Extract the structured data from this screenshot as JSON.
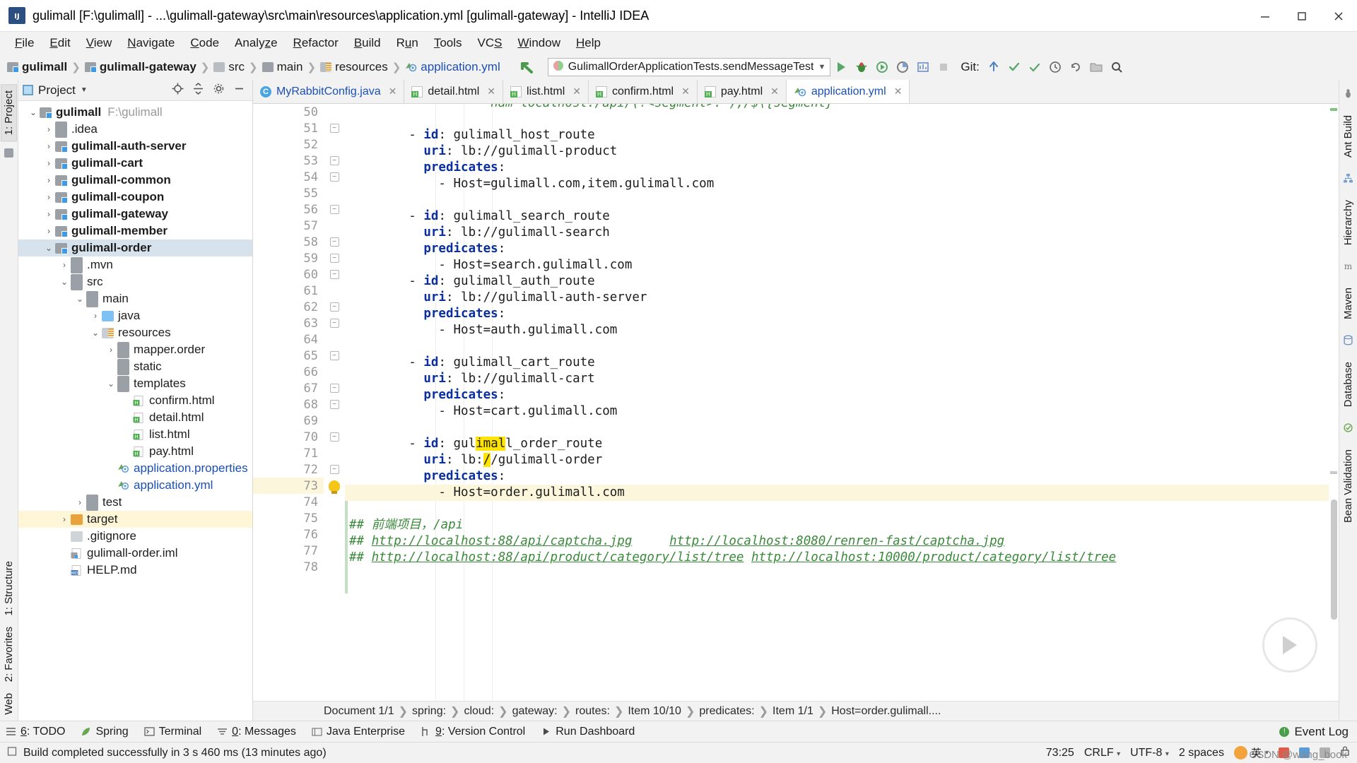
{
  "window": {
    "title": "gulimall [F:\\gulimall] - ...\\gulimall-gateway\\src\\main\\resources\\application.yml [gulimall-gateway] - IntelliJ IDEA",
    "app_icon_letter": "IJ",
    "minimize": "—",
    "maximize": "□",
    "close": "✕"
  },
  "menu": {
    "items": [
      {
        "label": "File"
      },
      {
        "label": "Edit"
      },
      {
        "label": "View"
      },
      {
        "label": "Navigate"
      },
      {
        "label": "Code"
      },
      {
        "label": "Analyze"
      },
      {
        "label": "Refactor"
      },
      {
        "label": "Build"
      },
      {
        "label": "Run"
      },
      {
        "label": "Tools"
      },
      {
        "label": "VCS"
      },
      {
        "label": "Window"
      },
      {
        "label": "Help"
      }
    ]
  },
  "navbar": {
    "crumbs": [
      {
        "label": "gulimall",
        "icon": "module-icon"
      },
      {
        "label": "gulimall-gateway",
        "icon": "module-icon"
      },
      {
        "label": "src",
        "icon": "source-folder-icon"
      },
      {
        "label": "main",
        "icon": "folder-icon"
      },
      {
        "label": "resources",
        "icon": "resources-folder-icon"
      },
      {
        "label": "application.yml",
        "icon": "yml-file-icon"
      }
    ],
    "run_config": "GulimallOrderApplicationTests.sendMessageTest",
    "git_label": "Git:",
    "actions": [
      "run-button",
      "debug-button",
      "run-coverage-button",
      "profiler-button",
      "build-button",
      "stop-button"
    ]
  },
  "project_panel": {
    "title": "Project",
    "header_actions": [
      "locate-icon",
      "collapse-all-icon",
      "settings-icon",
      "hide-icon"
    ],
    "tree": [
      {
        "label": "gulimall",
        "path": "F:\\gulimall",
        "depth": 0,
        "arrow": "down",
        "icon": "module-icon",
        "bold": true
      },
      {
        "label": ".idea",
        "depth": 1,
        "arrow": "right",
        "icon": "folder-icon"
      },
      {
        "label": "gulimall-auth-server",
        "depth": 1,
        "arrow": "right",
        "icon": "module-icon",
        "bold": true
      },
      {
        "label": "gulimall-cart",
        "depth": 1,
        "arrow": "right",
        "icon": "module-icon",
        "bold": true
      },
      {
        "label": "gulimall-common",
        "depth": 1,
        "arrow": "right",
        "icon": "module-icon",
        "bold": true
      },
      {
        "label": "gulimall-coupon",
        "depth": 1,
        "arrow": "right",
        "icon": "module-icon",
        "bold": true
      },
      {
        "label": "gulimall-gateway",
        "depth": 1,
        "arrow": "right",
        "icon": "module-icon",
        "bold": true
      },
      {
        "label": "gulimall-member",
        "depth": 1,
        "arrow": "right",
        "icon": "module-icon",
        "bold": true
      },
      {
        "label": "gulimall-order",
        "depth": 1,
        "arrow": "down",
        "icon": "module-icon",
        "bold": true,
        "selected": true
      },
      {
        "label": ".mvn",
        "depth": 2,
        "arrow": "right",
        "icon": "folder-icon"
      },
      {
        "label": "src",
        "depth": 2,
        "arrow": "down",
        "icon": "folder-icon"
      },
      {
        "label": "main",
        "depth": 3,
        "arrow": "down",
        "icon": "folder-icon"
      },
      {
        "label": "java",
        "depth": 4,
        "arrow": "right",
        "icon": "source-folder-icon"
      },
      {
        "label": "resources",
        "depth": 4,
        "arrow": "down",
        "icon": "resources-folder-icon"
      },
      {
        "label": "mapper.order",
        "depth": 5,
        "arrow": "right",
        "icon": "folder-icon"
      },
      {
        "label": "static",
        "depth": 5,
        "arrow": "none",
        "icon": "folder-icon"
      },
      {
        "label": "templates",
        "depth": 5,
        "arrow": "down",
        "icon": "folder-icon"
      },
      {
        "label": "confirm.html",
        "depth": 6,
        "arrow": "none",
        "icon": "html-file-icon"
      },
      {
        "label": "detail.html",
        "depth": 6,
        "arrow": "none",
        "icon": "html-file-icon"
      },
      {
        "label": "list.html",
        "depth": 6,
        "arrow": "none",
        "icon": "html-file-icon"
      },
      {
        "label": "pay.html",
        "depth": 6,
        "arrow": "none",
        "icon": "html-file-icon"
      },
      {
        "label": "application.properties",
        "depth": 5,
        "arrow": "none",
        "icon": "properties-file-icon",
        "color": "blue"
      },
      {
        "label": "application.yml",
        "depth": 5,
        "arrow": "none",
        "icon": "yml-file-icon",
        "color": "blue"
      },
      {
        "label": "test",
        "depth": 3,
        "arrow": "right",
        "icon": "folder-icon"
      },
      {
        "label": "target",
        "depth": 2,
        "arrow": "right",
        "icon": "target-folder-icon",
        "highlight": true
      },
      {
        "label": ".gitignore",
        "depth": 2,
        "arrow": "none",
        "icon": "file-icon"
      },
      {
        "label": "gulimall-order.iml",
        "depth": 2,
        "arrow": "none",
        "icon": "iml-file-icon"
      },
      {
        "label": "HELP.md",
        "depth": 2,
        "arrow": "none",
        "icon": "markdown-file-icon"
      }
    ]
  },
  "editor": {
    "tabs": [
      {
        "label": "MyRabbitConfig.java",
        "icon": "java-class-icon",
        "active": false
      },
      {
        "label": "detail.html",
        "icon": "html-file-icon",
        "active": false
      },
      {
        "label": "list.html",
        "icon": "html-file-icon",
        "active": false
      },
      {
        "label": "confirm.html",
        "icon": "html-file-icon",
        "active": false
      },
      {
        "label": "pay.html",
        "icon": "html-file-icon",
        "active": false
      },
      {
        "label": "application.yml",
        "icon": "yml-file-icon",
        "active": true
      }
    ],
    "first_line_number": 50,
    "highlight_line": 73,
    "lines": [
      {
        "n": 50,
        "text": "",
        "fold": ""
      },
      {
        "n": 51,
        "text": "        - id: gulimall_host_route",
        "fold": "collapse",
        "tokens": [
          {
            "t": "        - ",
            "c": ""
          },
          {
            "t": "id",
            "c": "kw"
          },
          {
            "t": ": gulimall_host_route",
            "c": ""
          }
        ]
      },
      {
        "n": 52,
        "text": "          uri: lb://gulimall-product",
        "fold": "",
        "tokens": [
          {
            "t": "          ",
            "c": ""
          },
          {
            "t": "uri",
            "c": "kw"
          },
          {
            "t": ": lb://gulimall-product",
            "c": ""
          }
        ]
      },
      {
        "n": 53,
        "text": "          predicates:",
        "fold": "collapse",
        "tokens": [
          {
            "t": "          ",
            "c": ""
          },
          {
            "t": "predicates",
            "c": "kw"
          },
          {
            "t": ":",
            "c": ""
          }
        ]
      },
      {
        "n": 54,
        "text": "            - Host=gulimall.com,item.gulimall.com",
        "fold": "collapse",
        "tokens": [
          {
            "t": "            - Host=gulimall.com,item.gulimall.com",
            "c": ""
          }
        ]
      },
      {
        "n": 55,
        "text": "",
        "fold": ""
      },
      {
        "n": 56,
        "text": "        - id: gulimall_search_route",
        "fold": "collapse",
        "tokens": [
          {
            "t": "        - ",
            "c": ""
          },
          {
            "t": "id",
            "c": "kw"
          },
          {
            "t": ": gulimall_search_route",
            "c": ""
          }
        ]
      },
      {
        "n": 57,
        "text": "          uri: lb://gulimall-search",
        "fold": "",
        "tokens": [
          {
            "t": "          ",
            "c": ""
          },
          {
            "t": "uri",
            "c": "kw"
          },
          {
            "t": ": lb://gulimall-search",
            "c": ""
          }
        ]
      },
      {
        "n": 58,
        "text": "          predicates:",
        "fold": "collapse",
        "tokens": [
          {
            "t": "          ",
            "c": ""
          },
          {
            "t": "predicates",
            "c": "kw"
          },
          {
            "t": ":",
            "c": ""
          }
        ]
      },
      {
        "n": 59,
        "text": "            - Host=search.gulimall.com",
        "fold": "collapse",
        "tokens": [
          {
            "t": "            - Host=search.gulimall.com",
            "c": ""
          }
        ]
      },
      {
        "n": 60,
        "text": "        - id: gulimall_auth_route",
        "fold": "collapse",
        "tokens": [
          {
            "t": "        - ",
            "c": ""
          },
          {
            "t": "id",
            "c": "kw"
          },
          {
            "t": ": gulimall_auth_route",
            "c": ""
          }
        ]
      },
      {
        "n": 61,
        "text": "          uri: lb://gulimall-auth-server",
        "fold": "",
        "tokens": [
          {
            "t": "          ",
            "c": ""
          },
          {
            "t": "uri",
            "c": "kw"
          },
          {
            "t": ": lb://gulimall-auth-server",
            "c": ""
          }
        ]
      },
      {
        "n": 62,
        "text": "          predicates:",
        "fold": "collapse",
        "tokens": [
          {
            "t": "          ",
            "c": ""
          },
          {
            "t": "predicates",
            "c": "kw"
          },
          {
            "t": ":",
            "c": ""
          }
        ]
      },
      {
        "n": 63,
        "text": "            - Host=auth.gulimall.com",
        "fold": "collapse",
        "tokens": [
          {
            "t": "            - Host=auth.gulimall.com",
            "c": ""
          }
        ]
      },
      {
        "n": 64,
        "text": "",
        "fold": ""
      },
      {
        "n": 65,
        "text": "        - id: gulimall_cart_route",
        "fold": "collapse",
        "tokens": [
          {
            "t": "        - ",
            "c": ""
          },
          {
            "t": "id",
            "c": "kw"
          },
          {
            "t": ": gulimall_cart_route",
            "c": ""
          }
        ]
      },
      {
        "n": 66,
        "text": "          uri: lb://gulimall-cart",
        "fold": "",
        "tokens": [
          {
            "t": "          ",
            "c": ""
          },
          {
            "t": "uri",
            "c": "kw"
          },
          {
            "t": ": lb://gulimall-cart",
            "c": ""
          }
        ]
      },
      {
        "n": 67,
        "text": "          predicates:",
        "fold": "collapse",
        "tokens": [
          {
            "t": "          ",
            "c": ""
          },
          {
            "t": "predicates",
            "c": "kw"
          },
          {
            "t": ":",
            "c": ""
          }
        ]
      },
      {
        "n": 68,
        "text": "            - Host=cart.gulimall.com",
        "fold": "collapse",
        "tokens": [
          {
            "t": "            - Host=cart.gulimall.com",
            "c": ""
          }
        ]
      },
      {
        "n": 69,
        "text": "",
        "fold": ""
      },
      {
        "n": 70,
        "text": "        - id: gulimall_order_route",
        "fold": "collapse",
        "tokens": [
          {
            "t": "        - ",
            "c": ""
          },
          {
            "t": "id",
            "c": "kw"
          },
          {
            "t": ": gul",
            "c": ""
          },
          {
            "t": "imal",
            "c": "hit"
          },
          {
            "t": "l_order_route",
            "c": ""
          }
        ]
      },
      {
        "n": 71,
        "text": "          uri: lb://gulimall-order",
        "fold": "",
        "tokens": [
          {
            "t": "          ",
            "c": ""
          },
          {
            "t": "uri",
            "c": "kw"
          },
          {
            "t": ": lb:",
            "c": ""
          },
          {
            "t": "/",
            "c": "hit"
          },
          {
            "t": "/gulimall-order",
            "c": ""
          }
        ]
      },
      {
        "n": 72,
        "text": "          predicates:",
        "fold": "collapse",
        "tokens": [
          {
            "t": "          ",
            "c": ""
          },
          {
            "t": "predicates",
            "c": "kw"
          },
          {
            "t": ":",
            "c": ""
          }
        ]
      },
      {
        "n": 73,
        "text": "            - Host=order.gulimall.com",
        "fold": "collapse",
        "bulb": true,
        "hl": true,
        "tokens": [
          {
            "t": "            - Host=order.gulimall.com",
            "c": ""
          }
        ]
      },
      {
        "n": 74,
        "text": "",
        "fold": ""
      },
      {
        "n": 75,
        "text": "## 前端项目，/api",
        "fold": "",
        "tokens": [
          {
            "t": "## 前端项目，/api",
            "c": "cm"
          }
        ]
      },
      {
        "n": 76,
        "text": "## http://localhost:88/api/captcha.jpg     http://localhost:8080/renren-fast/captcha.jpg",
        "fold": "",
        "tokens": [
          {
            "t": "## ",
            "c": "cm"
          },
          {
            "t": "http://localhost:88/api/captcha.jpg",
            "c": "lnk"
          },
          {
            "t": "     ",
            "c": "cm"
          },
          {
            "t": "http://localhost:8080/renren-fast/captcha.jpg",
            "c": "lnk"
          }
        ]
      },
      {
        "n": 77,
        "text": "## http://localhost:88/api/product/category/list/tree http://localhost:10000/product/category/list/tree",
        "fold": "",
        "tokens": [
          {
            "t": "## ",
            "c": "cm"
          },
          {
            "t": "http://localhost:88/api/product/category/list/tree",
            "c": "lnk"
          },
          {
            "t": " ",
            "c": "cm"
          },
          {
            "t": "http://localhost:10000/product/category/list/tree",
            "c": "lnk"
          }
        ]
      },
      {
        "n": 78,
        "text": "",
        "fold": ""
      }
    ],
    "breadcrumb": [
      "Document 1/1",
      "spring:",
      "cloud:",
      "gateway:",
      "routes:",
      "Item 10/10",
      "predicates:",
      "Item 1/1",
      "Host=order.gulimall...."
    ]
  },
  "left_strip": {
    "tabs": [
      "1: Project"
    ]
  },
  "left_strip_bottom": {
    "tabs": [
      "2: Favorites",
      "Web"
    ]
  },
  "right_strip": {
    "tabs": [
      "Ant Build",
      "Hierarchy",
      "Maven",
      "Database",
      "Bean Validation"
    ]
  },
  "bottom_tools": {
    "items": [
      {
        "label": "6: TODO",
        "icon": "todo-icon",
        "mnemonic": "6"
      },
      {
        "label": "Spring",
        "icon": "spring-leaf-icon"
      },
      {
        "label": "Terminal",
        "icon": "terminal-icon"
      },
      {
        "label": "0: Messages",
        "icon": "messages-icon",
        "mnemonic": "0"
      },
      {
        "label": "Java Enterprise",
        "icon": "java-enterprise-icon"
      },
      {
        "label": "9: Version Control",
        "icon": "version-control-icon",
        "mnemonic": "9"
      },
      {
        "label": "Run Dashboard",
        "icon": "run-dashboard-icon"
      }
    ],
    "event_log": "Event Log"
  },
  "status_bar": {
    "message": "Build completed successfully in 3 s 460 ms (13 minutes ago)",
    "caret": "73:25",
    "line_separator": "CRLF",
    "encoding": "UTF-8",
    "indent": "2 spaces",
    "ime": "英",
    "watermark": "CSDN @wang_book"
  },
  "colors": {
    "accent_blue": "#1a4fb4",
    "keyword": "#0a2f9e",
    "comment_green": "#3b8a3b",
    "highlight_yellow": "#ffe400",
    "selected_row": "#d6e3ec",
    "caret_row": "#fcf6dd",
    "target_row": "#fff6d8"
  }
}
